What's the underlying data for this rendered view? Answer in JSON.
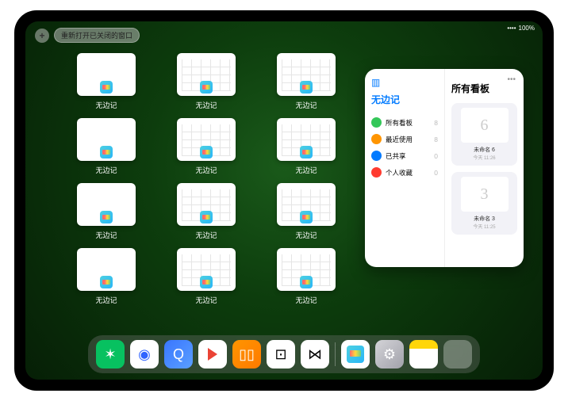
{
  "status": {
    "battery": "100%",
    "signal": "••••"
  },
  "topbar": {
    "plus": "+",
    "reopen_label": "重新打开已关闭的窗口"
  },
  "windows": [
    {
      "label": "无边记",
      "type": "blank"
    },
    {
      "label": "无边记",
      "type": "cal"
    },
    {
      "label": "无边记",
      "type": "cal"
    },
    {
      "label": "无边记",
      "type": "blank"
    },
    {
      "label": "无边记",
      "type": "cal"
    },
    {
      "label": "无边记",
      "type": "cal"
    },
    {
      "label": "无边记",
      "type": "blank"
    },
    {
      "label": "无边记",
      "type": "cal"
    },
    {
      "label": "无边记",
      "type": "cal"
    },
    {
      "label": "无边记",
      "type": "blank"
    },
    {
      "label": "无边记",
      "type": "cal"
    },
    {
      "label": "无边记",
      "type": "cal"
    }
  ],
  "popup": {
    "app_title": "无边记",
    "right_title": "所有看板",
    "items": [
      {
        "icon_color": "c1",
        "label": "所有看板",
        "count": "8"
      },
      {
        "icon_color": "c2",
        "label": "最近使用",
        "count": "8"
      },
      {
        "icon_color": "c3",
        "label": "已共享",
        "count": "0"
      },
      {
        "icon_color": "c4",
        "label": "个人收藏",
        "count": "0"
      }
    ],
    "boards": [
      {
        "glyph": "6",
        "label": "未命名 6",
        "sub": "今天 11:26"
      },
      {
        "glyph": "3",
        "label": "未命名 3",
        "sub": "今天 11:25"
      }
    ],
    "dots": "•••"
  },
  "dock": {
    "items": [
      {
        "name": "wechat",
        "glyph": "✶"
      },
      {
        "name": "browser1",
        "glyph": "◉"
      },
      {
        "name": "browser2",
        "glyph": "Q"
      },
      {
        "name": "play",
        "glyph": ""
      },
      {
        "name": "books",
        "glyph": "▯▯"
      },
      {
        "name": "dice",
        "glyph": "⊡"
      },
      {
        "name": "app7",
        "glyph": "⋈"
      },
      {
        "name": "freeform",
        "glyph": ""
      },
      {
        "name": "settings",
        "glyph": "⚙"
      },
      {
        "name": "notes",
        "glyph": ""
      },
      {
        "name": "folder",
        "glyph": ""
      }
    ]
  }
}
